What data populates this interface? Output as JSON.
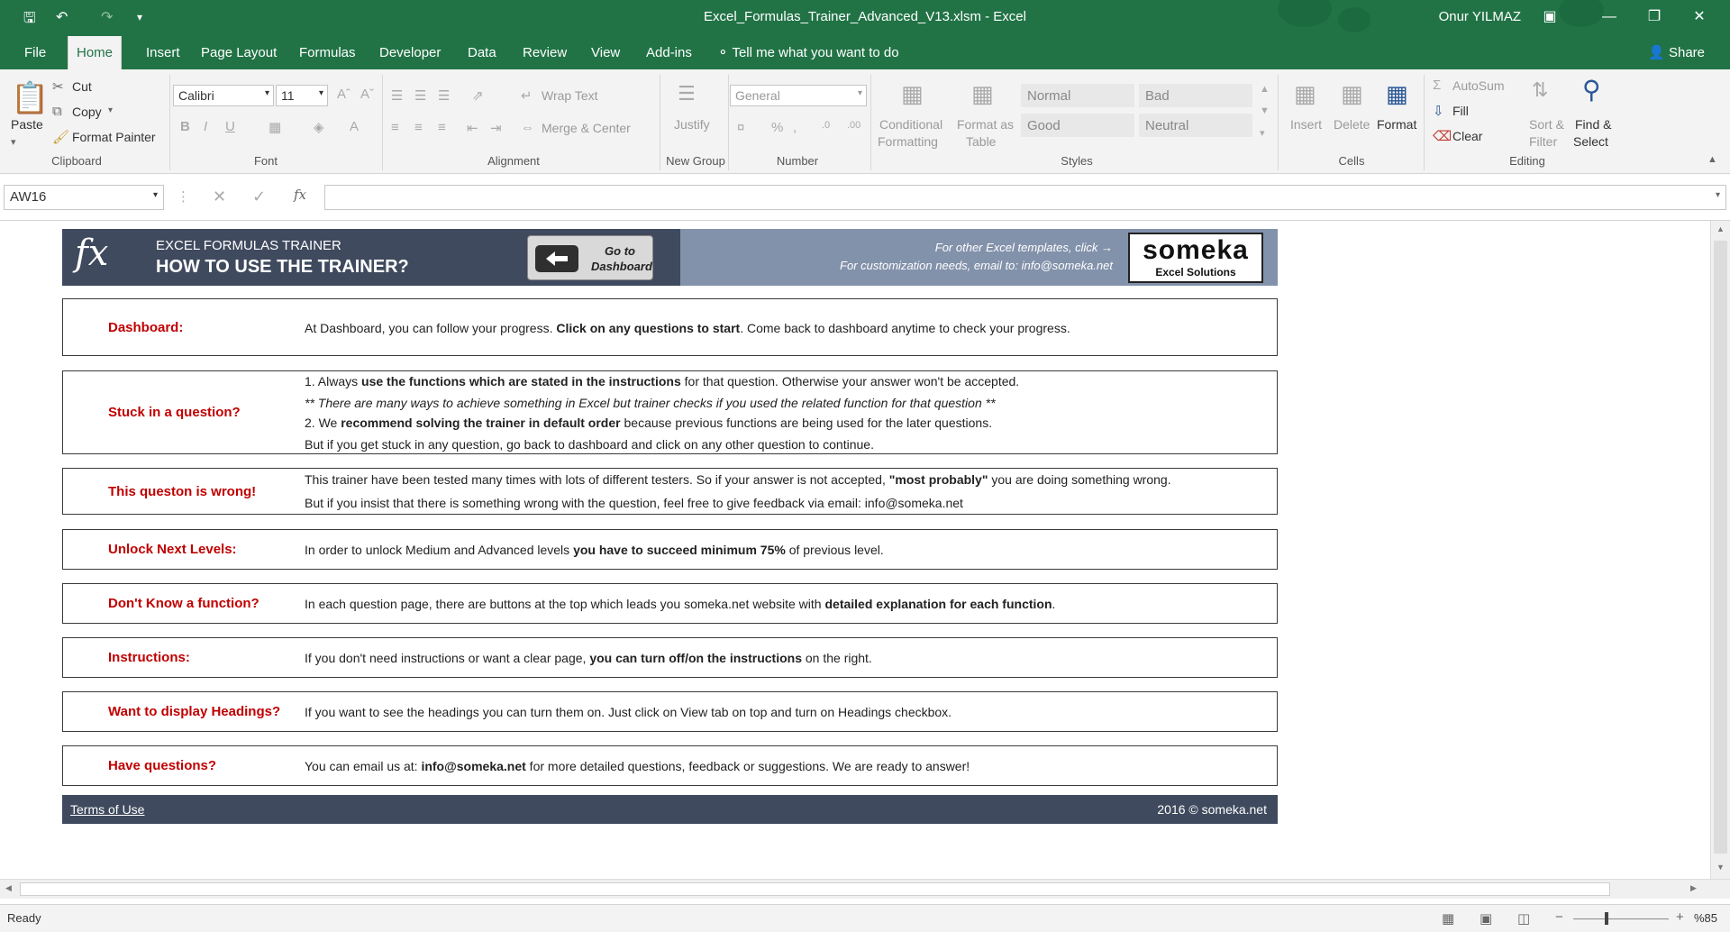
{
  "window": {
    "title": "Excel_Formulas_Trainer_Advanced_V13.xlsm - Excel",
    "user": "Onur YILMAZ"
  },
  "tabs": {
    "file": "File",
    "items": [
      "Home",
      "Insert",
      "Page Layout",
      "Formulas",
      "Developer",
      "Data",
      "Review",
      "View",
      "Add-ins"
    ],
    "tell_me": "Tell me what you want to do",
    "share": "Share"
  },
  "ribbon": {
    "clipboard": {
      "paste": "Paste",
      "cut": "Cut",
      "copy": "Copy",
      "format_painter": "Format Painter",
      "label": "Clipboard"
    },
    "font": {
      "name": "Calibri",
      "size": "11",
      "label": "Font"
    },
    "alignment": {
      "wrap_text": "Wrap Text",
      "merge_center": "Merge & Center",
      "label": "Alignment"
    },
    "new_group": {
      "justify": "Justify",
      "label": "New Group"
    },
    "number": {
      "format": "General",
      "label": "Number"
    },
    "styles": {
      "conditional": "Conditional",
      "formatting": "Formatting",
      "format_as": "Format as",
      "table": "Table",
      "normal": "Normal",
      "bad": "Bad",
      "good": "Good",
      "neutral": "Neutral",
      "label": "Styles"
    },
    "cells": {
      "insert": "Insert",
      "delete": "Delete",
      "format": "Format",
      "label": "Cells"
    },
    "editing": {
      "autosum": "AutoSum",
      "fill": "Fill",
      "clear": "Clear",
      "sort": "Sort &",
      "filter": "Filter",
      "find": "Find &",
      "select": "Select",
      "label": "Editing"
    }
  },
  "formula_bar": {
    "name_box": "AW16"
  },
  "header": {
    "subtitle": "EXCEL FORMULAS TRAINER",
    "title": "HOW TO USE THE TRAINER?",
    "goto_line1": "Go to",
    "goto_line2": "Dashboard",
    "other_templates": "For other Excel templates, click →",
    "customization": "For customization needs, email to: info@someka.net",
    "logo_big": "someka",
    "logo_small": "Excel Solutions"
  },
  "rows": [
    {
      "label": "Dashboard:",
      "lines": [
        [
          "At Dashboard, you can follow your progress. ",
          "Click on any questions to start",
          ". Come back to dashboard anytime to check your progress."
        ]
      ]
    },
    {
      "label": "Stuck in a question?",
      "lines": [
        [
          "1. Always ",
          "use the functions which are stated in the instructions",
          " for that question. Otherwise your answer won't be accepted."
        ],
        [
          "** There are many ways to achieve something in Excel but trainer checks if you used the related function for that question **",
          "",
          ""
        ],
        [
          "2. We ",
          "recommend solving the trainer in default order",
          " because previous functions are being used for the later questions."
        ],
        [
          "But if you get stuck in any question, go back to dashboard and click on any other question to continue.",
          "",
          ""
        ]
      ]
    },
    {
      "label": "This queston is wrong!",
      "lines": [
        [
          "This trainer have been tested many times with lots of different testers. So if your answer is not accepted, ",
          "\"most probably\"",
          " you are doing something wrong."
        ],
        [
          "But if you insist that there is something wrong with the question, feel free to give feedback via email: info@someka.net",
          "",
          ""
        ]
      ]
    },
    {
      "label": "Unlock Next Levels:",
      "lines": [
        [
          "In order to unlock Medium and Advanced levels ",
          "you have to succeed minimum 75%",
          " of previous level."
        ]
      ]
    },
    {
      "label": "Don't Know a function?",
      "lines": [
        [
          "In each question page, there are buttons at the top which leads you someka.net website with ",
          "detailed explanation for each function",
          "."
        ]
      ]
    },
    {
      "label": "Instructions:",
      "lines": [
        [
          "If you don't need instructions or want a clear page, ",
          "you can turn off/on the instructions",
          " on the right."
        ]
      ]
    },
    {
      "label": "Want to display Headings?",
      "lines": [
        [
          "If you want to see the headings you can turn them on. Just click on View tab on top and turn on Headings checkbox.",
          "",
          ""
        ]
      ]
    },
    {
      "label": "Have questions?",
      "lines": [
        [
          "You can email us at: ",
          "info@someka.net",
          " for more detailed questions, feedback or suggestions. We are ready to answer!"
        ]
      ]
    }
  ],
  "footer": {
    "terms": "Terms of Use",
    "copyright": "2016 © someka.net"
  },
  "status": {
    "ready": "Ready",
    "zoom": "%85"
  }
}
